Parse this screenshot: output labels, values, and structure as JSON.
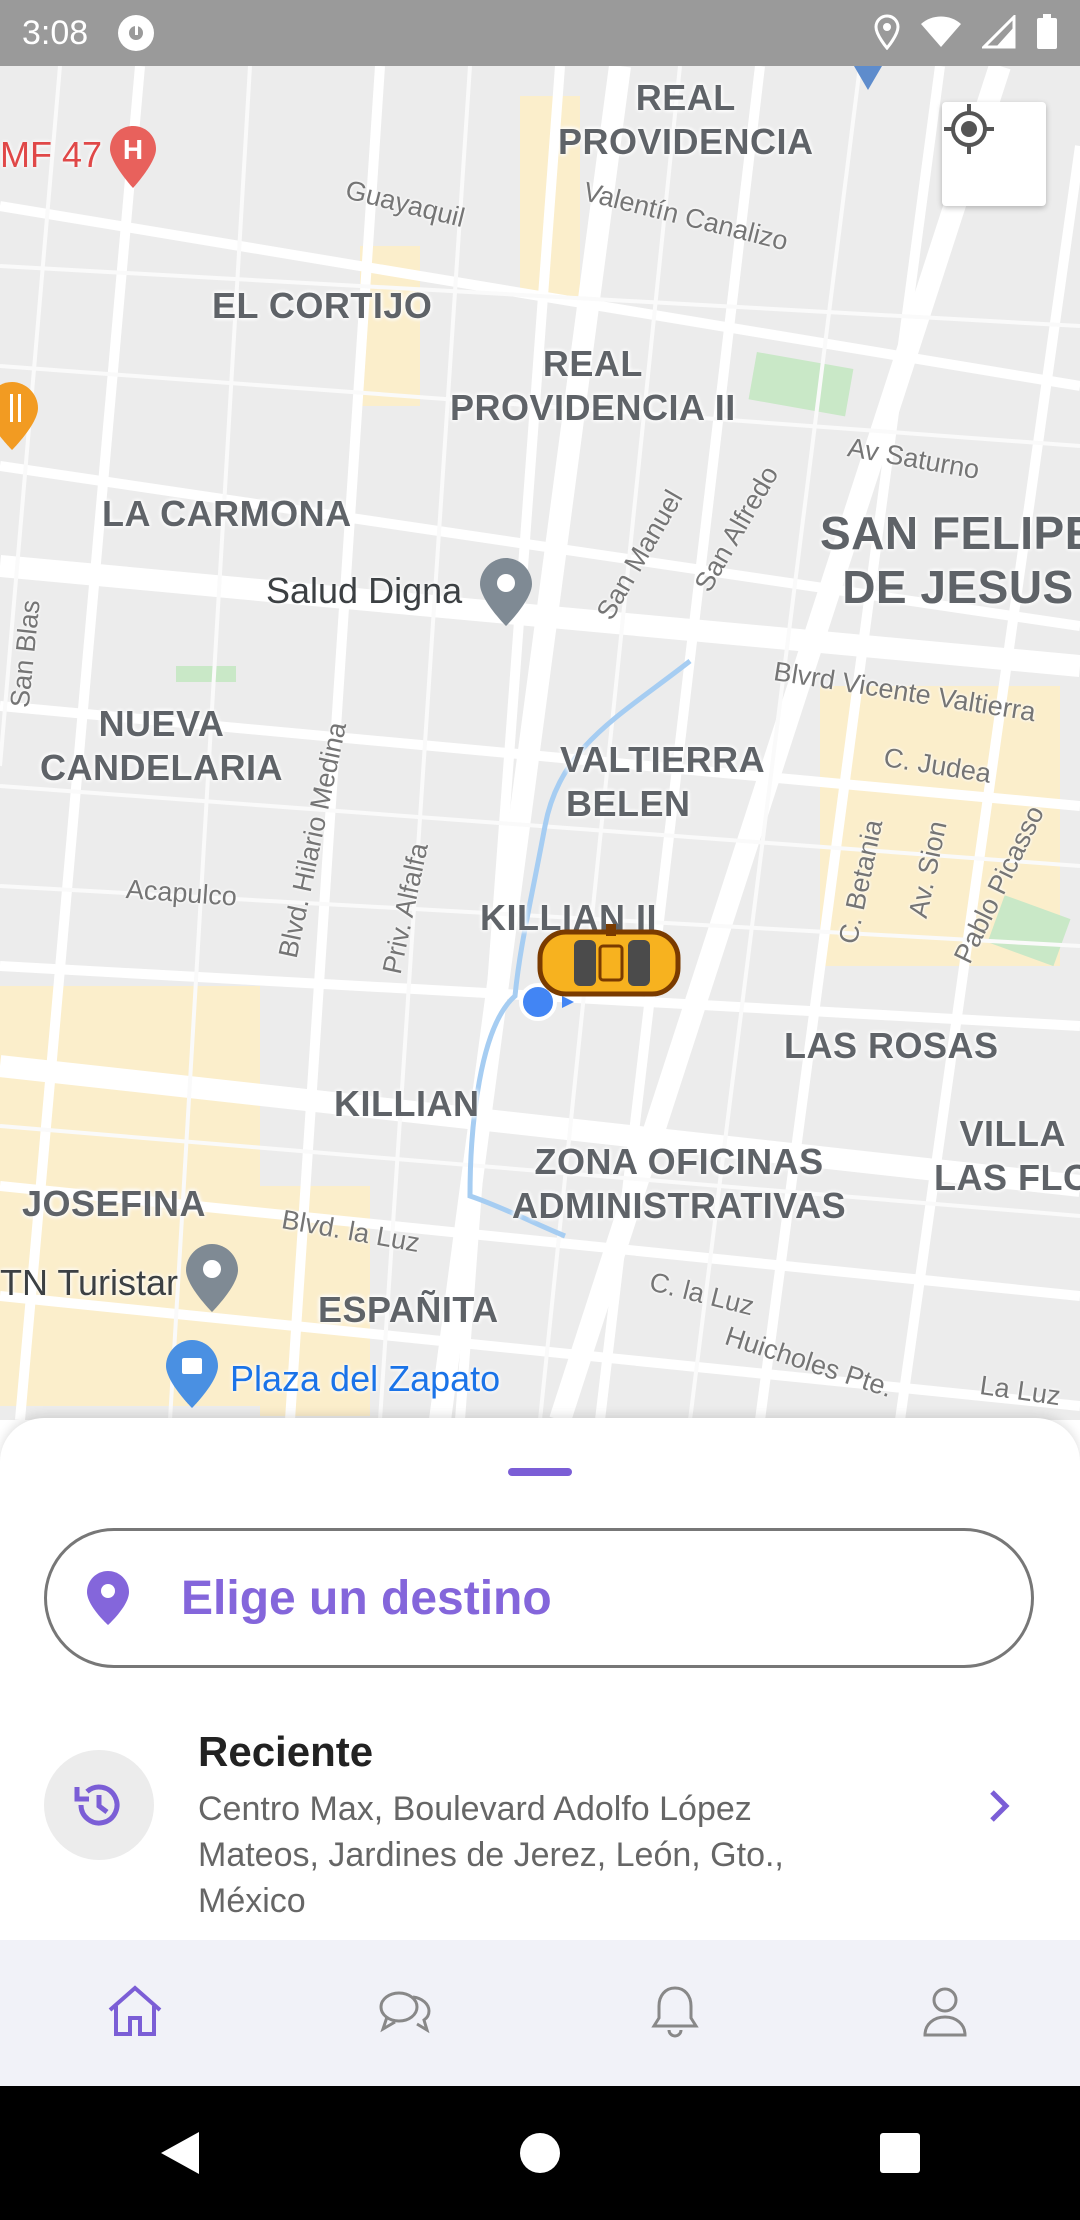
{
  "status_bar": {
    "time": "3:08",
    "icons": [
      "app-notification-icon",
      "location-icon",
      "wifi-icon",
      "signal-icon",
      "battery-icon"
    ]
  },
  "map": {
    "neighborhoods": {
      "real_providencia": "REAL\nPROVIDENCIA",
      "el_cortijo": "EL CORTIJO",
      "real_providencia_ii": "REAL\nPROVIDENCIA II",
      "la_carmona": "LA CARMONA",
      "san_felipe": "SAN FELIPE\nDE JESUS",
      "nueva_candelaria": "NUEVA\nCANDELARIA",
      "valtierra": "VALTIERRA",
      "belen": "BELEN",
      "killian_ii": "KILLIAN II",
      "las_rosas": "LAS ROSAS",
      "killian": "KILLIAN",
      "villa_las_flores": "VILLA\nLAS FLO",
      "zona_oficinas": "ZONA OFICINAS\nADMINISTRATIVAS",
      "josefina": "JOSEFINA",
      "espanita": "ESPAÑITA"
    },
    "streets": {
      "guayaquil": "Guayaquil",
      "valentin": "Valentín Canalizo",
      "av_saturno": "Av Saturno",
      "san_manuel": "San Manuel",
      "san_alfredo": "San Alfredo",
      "san_blas": "San Blas",
      "vicente": "Blvrd Vicente Valtierra",
      "c_judea": "C. Judea",
      "hilario": "Blvd. Hilario Medina",
      "alfalfa": "Priv. Alfalfa",
      "acapulco": "Acapulco",
      "betania": "C. Betania",
      "av_sion": "Av. Sion",
      "picasso": "Pablo Picasso",
      "la_luz_blvd": "Blvd. la Luz",
      "c_la_luz": "C. la Luz",
      "huicholes": "Huicholes Pte.",
      "la_luz": "La Luz"
    },
    "pois": {
      "hospital": "MF 47",
      "salud_digna": "Salud Digna",
      "turistar": "TN Turistar",
      "plaza_zapato": "Plaza del Zapato"
    },
    "colors": {
      "poi_text": "#3c4043",
      "plaza_text": "#1a73e8"
    }
  },
  "sheet": {
    "destination_placeholder": "Elige un destino",
    "recent": {
      "title": "Reciente",
      "address": "Centro Max, Boulevard Adolfo López Mateos, Jardines de Jerez, León, Gto., México"
    },
    "accent_color": "#7b5ed6"
  },
  "bottom_nav": {
    "tabs": [
      "home-icon",
      "chat-icon",
      "bell-icon",
      "profile-icon"
    ],
    "active": "home-icon"
  }
}
